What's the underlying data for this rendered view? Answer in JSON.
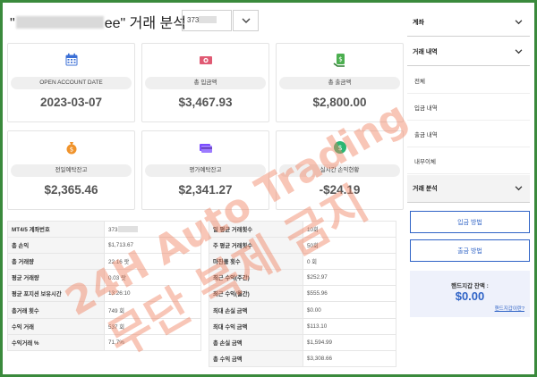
{
  "header": {
    "title_prefix": "\"",
    "title_suffix": "ee\" 거래 분석",
    "account_value": "373",
    "dropdown_icon": "chevron-down-icon"
  },
  "cards": [
    {
      "label": "OPEN ACCOUNT DATE",
      "value": "2023-03-07",
      "icon": "calendar-icon",
      "color": "#3b6fd6"
    },
    {
      "label": "총 입금액",
      "value": "$3,467.93",
      "icon": "money-icon",
      "color": "#e05a73"
    },
    {
      "label": "총 출금액",
      "value": "$2,800.00",
      "icon": "withdraw-icon",
      "color": "#4caf50"
    },
    {
      "label": "전일예탁잔고",
      "value": "$2,365.46",
      "icon": "money-bag-icon",
      "color": "#f0932b"
    },
    {
      "label": "평가예탁잔고",
      "value": "$2,341.27",
      "icon": "credit-card-icon",
      "color": "#7c4dff"
    },
    {
      "label": "실시간 손익현황",
      "value": "-$24.19",
      "icon": "exchange-icon",
      "color": "#2bb673"
    }
  ],
  "left_table": [
    {
      "k": "MT4/5 계좌번호",
      "v": "373"
    },
    {
      "k": "총 손익",
      "v": "$1,713.67"
    },
    {
      "k": "총 거래량",
      "v": "22.16 랏"
    },
    {
      "k": "평균 거래량",
      "v": "0.03 랏"
    },
    {
      "k": "평균 포지션 보유시간",
      "v": "13:26:10"
    },
    {
      "k": "총거래 횟수",
      "v": "749 회"
    },
    {
      "k": "수익 거래",
      "v": "537 회"
    },
    {
      "k": "수익거래 %",
      "v": "71.7%"
    }
  ],
  "right_table": [
    {
      "k": "일 평균 거래횟수",
      "v": "10회"
    },
    {
      "k": "주 평균 거래횟수",
      "v": "50회"
    },
    {
      "k": "마진콜 횟수",
      "v": "0 회"
    },
    {
      "k": "최근 수익(주간)",
      "v": "$252.97"
    },
    {
      "k": "최근 수익(월간)",
      "v": "$555.96"
    },
    {
      "k": "최대 손실 금액",
      "v": "$0.00"
    },
    {
      "k": "최대 수익 금액",
      "v": "$113.10"
    },
    {
      "k": "총 손실 금액",
      "v": "$1,594.99"
    },
    {
      "k": "총 수익 금액",
      "v": "$3,308.66"
    }
  ],
  "sidebar": {
    "account_section": "계좌",
    "trade_history_section": "거래 내역",
    "items": [
      "전체",
      "입금 내역",
      "출금 내역",
      "내부이체"
    ],
    "analysis_section": "거래 분석",
    "deposit_button": "입금 방법",
    "withdraw_button": "출금 방법",
    "wallet_label": "핸드지갑 잔액 :",
    "wallet_value": "$0.00",
    "wallet_link": "핸드지갑이란?"
  },
  "watermark": {
    "line1": "24H Auto Trading",
    "line2": "무단 복제 금지",
    "color": "#f08060"
  },
  "colors": {
    "frame_border": "#3a8a3c",
    "accent": "#2f63c6"
  }
}
